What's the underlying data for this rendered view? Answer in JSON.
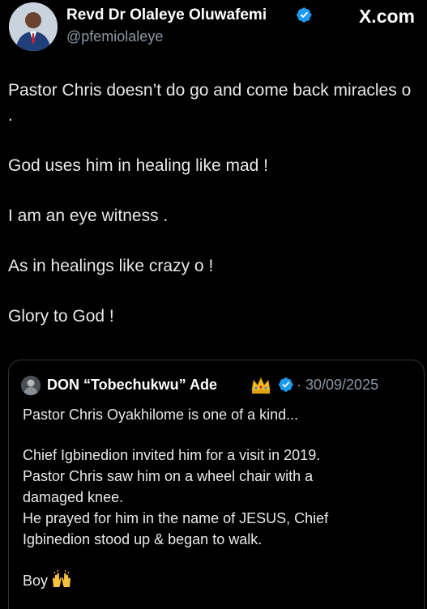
{
  "author": {
    "name": "Revd Dr Olaleye Oluwafemi",
    "handle": "@pfemiolaleye",
    "avatar_icon": "profile-photo-avatar",
    "verified_icon": "verified-badge-icon"
  },
  "brand": "X.com",
  "tweet": {
    "paragraphs": [
      "Pastor Chris doesn’t do go and come back miracles o .",
      "God uses him in healing like mad !",
      "I am an eye witness .",
      "As in healings like crazy o !",
      "Glory to God !"
    ]
  },
  "quote": {
    "name": "DON “Tobechukwu” Ade",
    "date": "· 30/09/2025",
    "crown_icon": "crown-emoji-icon",
    "verified_icon": "verified-badge-icon",
    "lines": [
      "Pastor Chris Oyakhilome is one of a kind...",
      "Chief Igbinedion invited him for a visit in 2019.",
      "Pastor Chris saw him on a wheel chair with a",
      "damaged knee.",
      "He prayed for him in the name of JESUS, Chief",
      "Igbinedion stood up & began to walk.",
      "Boy"
    ],
    "boy_emoji_icon": "raising-hands-emoji-icon"
  },
  "colors": {
    "background": "#000000",
    "text": "#e7e9ea",
    "muted": "#8b98a5",
    "verified": "#1d9bf0",
    "border": "#2f3336"
  }
}
